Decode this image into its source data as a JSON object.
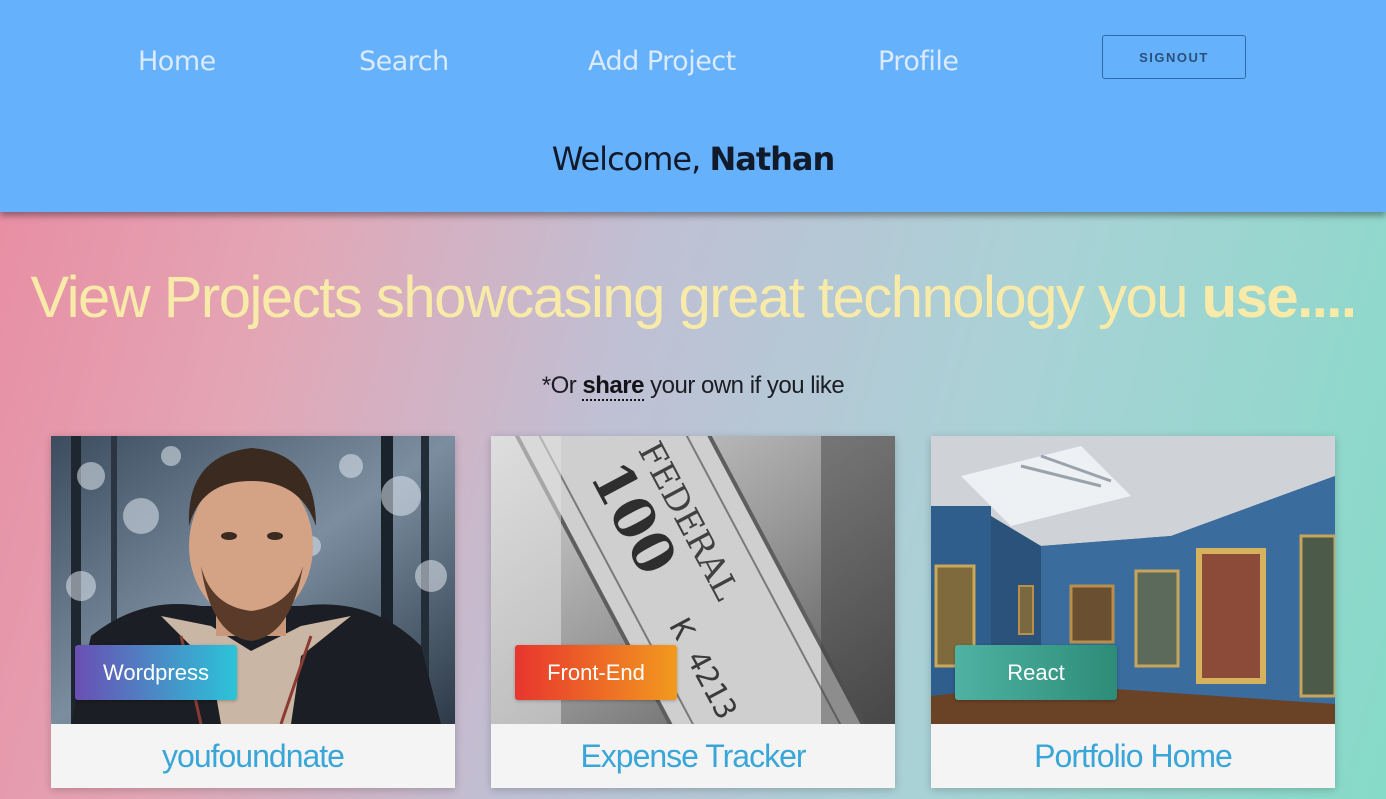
{
  "nav": {
    "home": "Home",
    "search": "Search",
    "add_project": "Add Project",
    "profile": "Profile",
    "signout": "SIGNOUT"
  },
  "welcome": {
    "prefix": "Welcome, ",
    "name": "Nathan"
  },
  "hero": {
    "title_regular": "View Projects showcasing great technology you ",
    "title_bold": "use....",
    "subtitle_prefix": "*Or ",
    "subtitle_link": "share",
    "subtitle_suffix": " your own if you like"
  },
  "cards": [
    {
      "badge": "Wordpress",
      "title": "youfoundnate"
    },
    {
      "badge": "Front-End",
      "title": "Expense Tracker"
    },
    {
      "badge": "React",
      "title": "Portfolio Home"
    }
  ],
  "colors": {
    "header_bg": "#66b1fc",
    "hero_title": "#f8eaa8",
    "card_title": "#3aa6d8",
    "badge_wordpress": [
      "#6a4fb3",
      "#2bc4d8"
    ],
    "badge_frontend": [
      "#e8352e",
      "#f29a1e"
    ],
    "badge_react": [
      "#4fb2a2",
      "#2c8c78"
    ]
  }
}
